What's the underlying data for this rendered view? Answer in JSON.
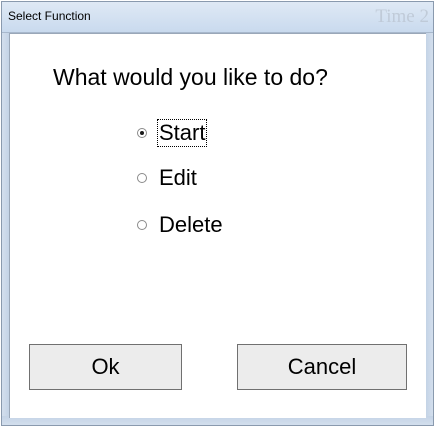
{
  "window": {
    "title": "Select Function",
    "background_window_text": "Time 2"
  },
  "dialog": {
    "prompt": "What would you like to do?",
    "options": [
      {
        "label": "Start",
        "selected": true,
        "focused": true
      },
      {
        "label": "Edit",
        "selected": false,
        "focused": false
      },
      {
        "label": "Delete",
        "selected": false,
        "focused": false
      }
    ],
    "buttons": {
      "ok_label": "Ok",
      "cancel_label": "Cancel"
    }
  },
  "colors": {
    "titlebar": "#c9daee",
    "window_border": "#8a9aae",
    "button_face": "#ececec",
    "button_border": "#707070"
  },
  "icons": {
    "radio_selected": "radio-selected-icon",
    "radio_unselected": "radio-unselected-icon"
  }
}
